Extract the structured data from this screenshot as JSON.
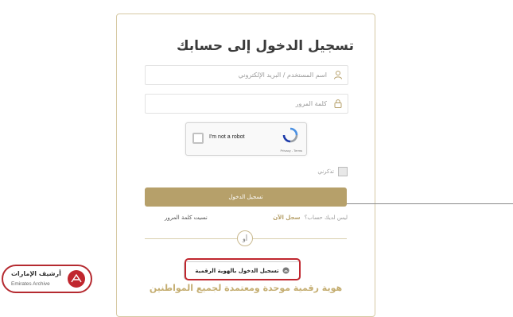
{
  "login": {
    "title": "تسجيل الدخول إلى حسابك",
    "username_placeholder": "اسم المستخدم / البريد الإلكتروني",
    "password_placeholder": "كلمة المرور",
    "remember_label": "تذكرني",
    "login_button": "تسجيل الدخول",
    "no_account_text": "ليس لديك حساب؟",
    "register_link": "سجل الآن",
    "forgot_password": "نسيت كلمة المرور",
    "or_label": "أو",
    "uae_pass_button": "تسجيل الدخول بالهوية الرقمية",
    "tagline": "هوية رقمية موحدة ومعتمدة لجميع المواطنين"
  },
  "recaptcha": {
    "label": "I'm not a robot",
    "terms": "Privacy - Terms"
  },
  "watermark": {
    "arabic": "أرشيف الإمارات",
    "english": "Emirates Archive"
  },
  "colors": {
    "accent_gold": "#b6a06a",
    "highlight_red": "#c0262e"
  }
}
